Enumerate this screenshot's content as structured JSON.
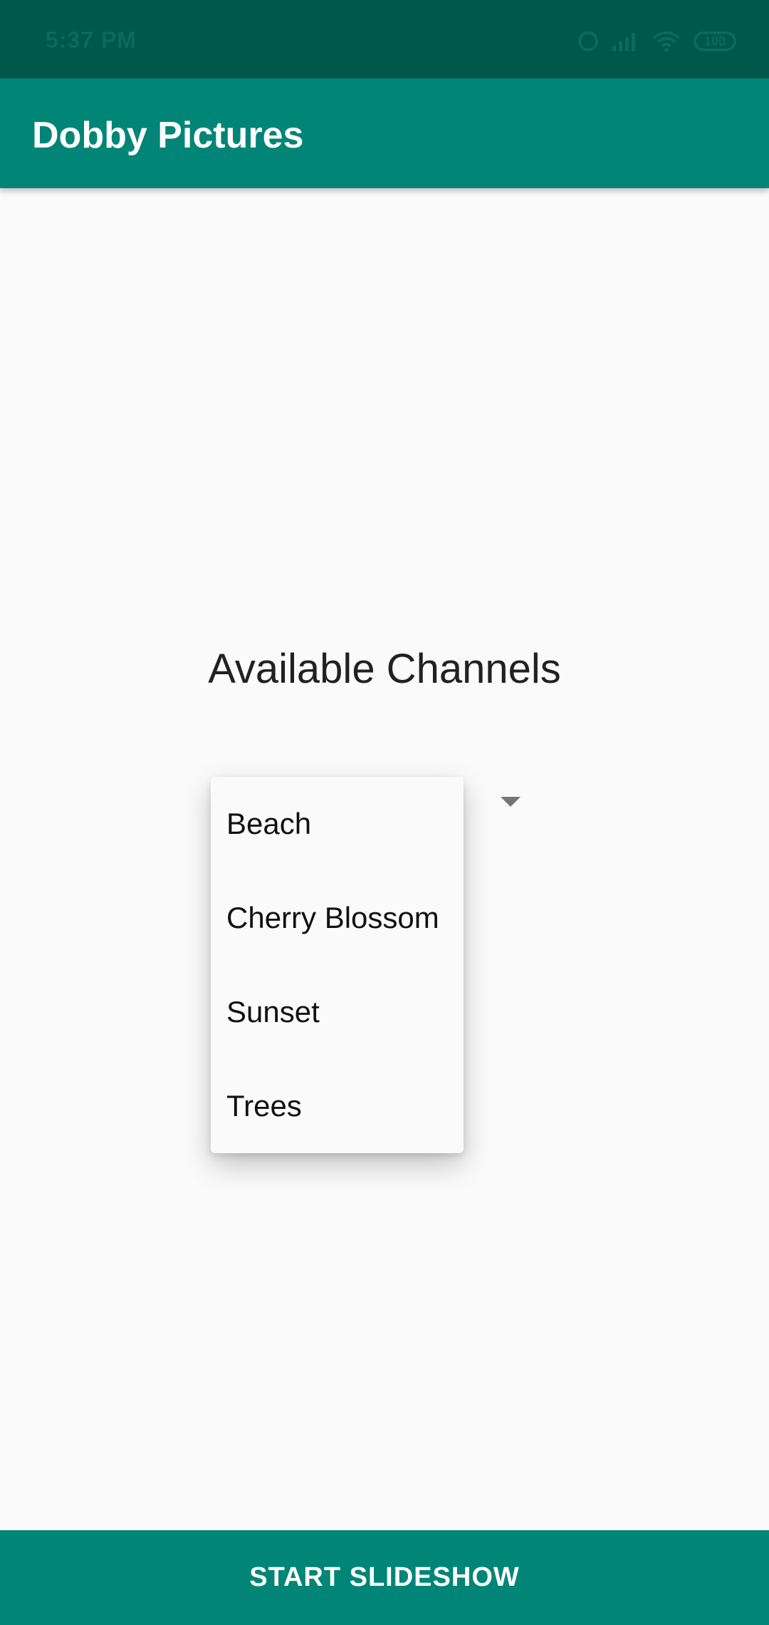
{
  "status_bar": {
    "time": "5:37 PM",
    "battery": "100",
    "icons": [
      "alarm-icon",
      "signal-icon",
      "wifi-icon",
      "battery-icon"
    ]
  },
  "app_bar": {
    "title": "Dobby Pictures"
  },
  "main": {
    "heading": "Available Channels",
    "spinner_icon": "dropdown-arrow-icon"
  },
  "dropdown": {
    "items": [
      {
        "label": "Beach"
      },
      {
        "label": "Cherry Blossom"
      },
      {
        "label": "Sunset"
      },
      {
        "label": "Trees"
      }
    ]
  },
  "footer": {
    "start_label": "START SLIDESHOW"
  },
  "colors": {
    "status_bar": "#00574b",
    "primary": "#008577",
    "background": "#fafafa",
    "text": "#212121"
  }
}
